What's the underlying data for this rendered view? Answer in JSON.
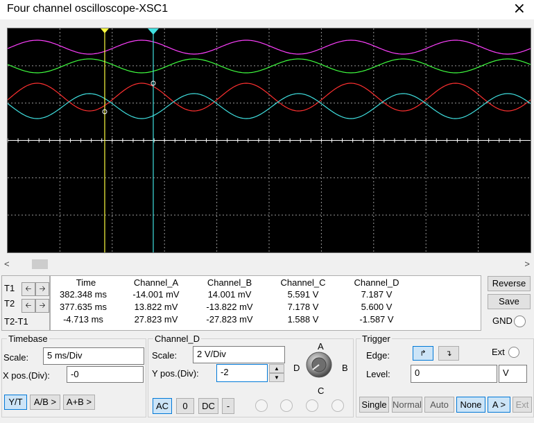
{
  "window": {
    "title": "Four channel oscilloscope-XSC1",
    "close_icon": "×"
  },
  "readout": {
    "headers": [
      "Time",
      "Channel_A",
      "Channel_B",
      "Channel_C",
      "Channel_D"
    ],
    "rows": [
      {
        "label": "T1",
        "values": [
          "382.348 ms",
          "-14.001 mV",
          "14.001 mV",
          "5.591 V",
          "7.187 V"
        ]
      },
      {
        "label": "T2",
        "values": [
          "377.635 ms",
          "13.822 mV",
          "-13.822 mV",
          "7.178 V",
          "5.600 V"
        ]
      },
      {
        "label": "T2-T1",
        "values": [
          "-4.713 ms",
          "27.823 mV",
          "-27.823 mV",
          "1.588 V",
          "-1.587 V"
        ]
      }
    ]
  },
  "side_buttons": {
    "reverse": "Reverse",
    "save": "Save",
    "gnd": "GND"
  },
  "timebase": {
    "title": "Timebase",
    "scale_label": "Scale:",
    "scale_value": "5 ms/Div",
    "xpos_label": "X pos.(Div):",
    "xpos_value": "-0",
    "modes": [
      "Y/T",
      "A/B >",
      "A+B >"
    ]
  },
  "channel": {
    "title": "Channel_D",
    "scale_label": "Scale:",
    "scale_value": "2  V/Div",
    "ypos_label": "Y pos.(Div):",
    "ypos_value": "-2",
    "coupling": [
      "AC",
      "0",
      "DC",
      "-"
    ],
    "knob_labels": [
      "A",
      "B",
      "C",
      "D"
    ]
  },
  "trigger": {
    "title": "Trigger",
    "edge_label": "Edge:",
    "level_label": "Level:",
    "level_value": "0",
    "level_unit": "V",
    "ext_label": "Ext",
    "modes": [
      "Single",
      "Normal",
      "Auto",
      "None",
      "A >",
      "Ext"
    ]
  },
  "colors": {
    "channel_a": "#ff40ff",
    "channel_b": "#40ff40",
    "channel_c": "#ff3030",
    "channel_d": "#40e0e0",
    "cursor1": "#ffff40",
    "cursor2": "#40e0e0",
    "screen": "#000000"
  },
  "waveform": {
    "period_ms": 10,
    "cursor1_time_ms": 382.348,
    "cursor2_time_ms": 377.635
  }
}
